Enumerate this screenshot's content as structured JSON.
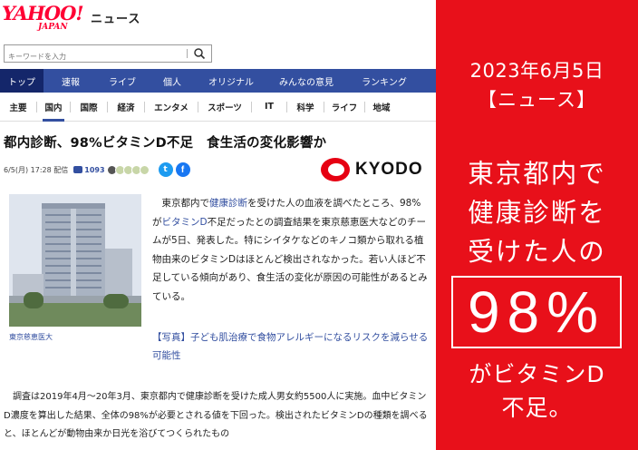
{
  "header": {
    "logo_main": "YAHOO!",
    "logo_sub": "JAPAN",
    "logo_section": "ニュース"
  },
  "search": {
    "placeholder": "キーワードを入力"
  },
  "nav_main": {
    "items": [
      {
        "label": "トップ",
        "active": true
      },
      {
        "label": "速報"
      },
      {
        "label": "ライブ"
      },
      {
        "label": "個人"
      },
      {
        "label": "オリジナル"
      },
      {
        "label": "みんなの意見"
      },
      {
        "label": "ランキング"
      }
    ]
  },
  "nav_sub": {
    "items": [
      {
        "label": "主要"
      },
      {
        "label": "国内",
        "active": true
      },
      {
        "label": "国際"
      },
      {
        "label": "経済"
      },
      {
        "label": "エンタメ"
      },
      {
        "label": "スポーツ"
      },
      {
        "label": "IT"
      },
      {
        "label": "科学"
      },
      {
        "label": "ライフ"
      },
      {
        "label": "地域"
      }
    ]
  },
  "article": {
    "title": "都内診断、98%ビタミンD不足　食生活の変化影響か",
    "date": "6/5(月) 17:28 配信",
    "comment_count": "1093",
    "source": "KYODO",
    "photo_caption": "東京慈恵医大",
    "body1_pre": "東京都内で",
    "body1_link1": "健康診断",
    "body1_mid": "を受けた人の血液を調べたところ、98%が",
    "body1_link2": "ビタミンD",
    "body1_post": "不足だったとの調査結果を東京慈恵医大などのチームが5日、発表した。特にシイタケなどのキノコ類から取れる植物由来のビタミンDはほとんど検出されなかった。若い人ほど不足している傾向があり、食生活の変化が原因の可能性があるとみている。",
    "related": "【写真】子ども肌治療で食物アレルギーになるリスクを減らせる可能性",
    "body2": "調査は2019年4月～20年3月、東京都内で健康診断を受けた成人男女約5500人に実施。血中ビタミンD濃度を算出した結果、全体の98%が必要とされる値を下回った。検出されたビタミンDの種類を調べると、ほとんどが動物由来か日光を浴びてつくられたもの"
  },
  "panel": {
    "date": "2023年6月5日",
    "tag": "【ニュース】",
    "headline_lines": [
      "東京都内で",
      "健康診断を",
      "受けた人の"
    ],
    "percent": "98%",
    "footer_lines": [
      "がビタミンD",
      "不足。"
    ]
  },
  "colors": {
    "nav_blue": "#334fa0",
    "nav_active": "#14266a",
    "panel_red": "#e8101a",
    "link_blue": "#334fa0",
    "yahoo_red": "#ff0033"
  }
}
